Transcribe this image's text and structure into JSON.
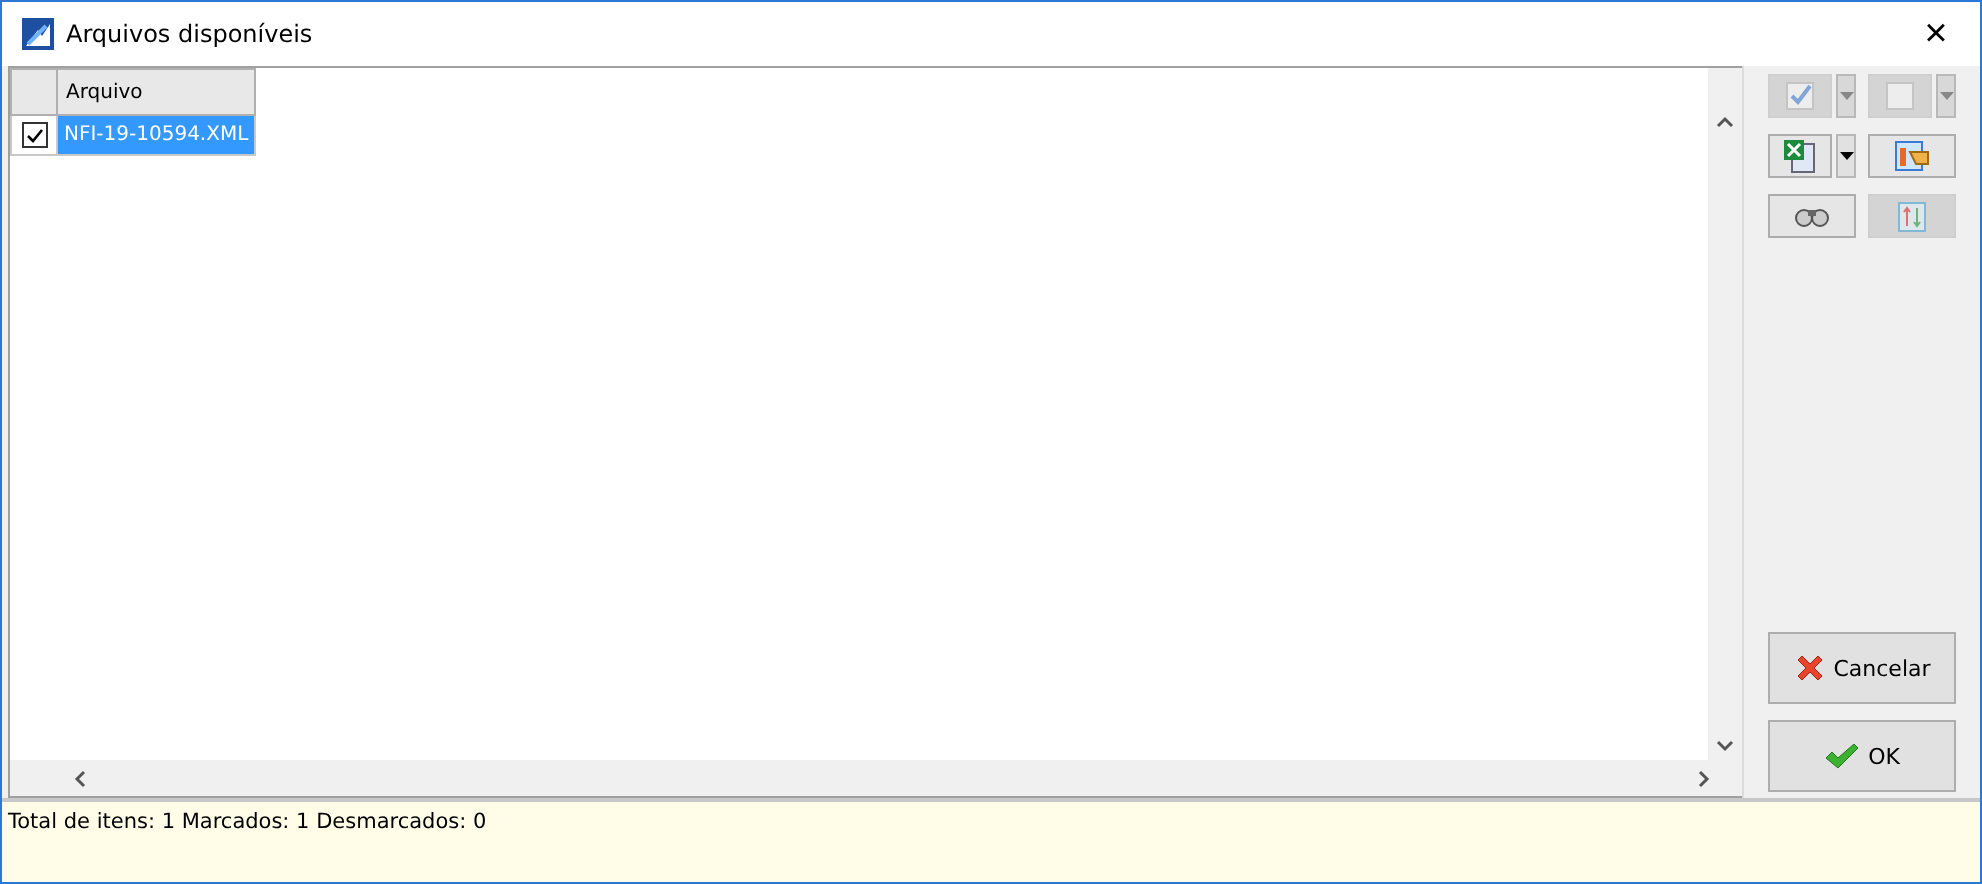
{
  "window": {
    "title": "Arquivos disponíveis",
    "close": "×"
  },
  "table": {
    "columns": [
      "Arquivo"
    ],
    "rows": [
      {
        "checked": true,
        "selected": true,
        "file": "NFI-19-10594.XML"
      }
    ]
  },
  "toolbar": [
    {
      "kind": "check-all",
      "disabled": true,
      "dropdown": true
    },
    {
      "kind": "uncheck-all",
      "disabled": true,
      "dropdown": true
    },
    {
      "kind": "excel",
      "disabled": false,
      "dropdown": true
    },
    {
      "kind": "grid-export",
      "disabled": false,
      "dropdown": false
    },
    {
      "kind": "find",
      "disabled": false,
      "dropdown": false
    },
    {
      "kind": "sort",
      "disabled": true,
      "dropdown": false
    }
  ],
  "actions": [
    {
      "kind": "cancel",
      "label": "Cancelar"
    },
    {
      "kind": "ok",
      "label": "OK"
    }
  ],
  "status_bar": "Total de itens: 1 Marcados: 1 Desmarcados: 0"
}
